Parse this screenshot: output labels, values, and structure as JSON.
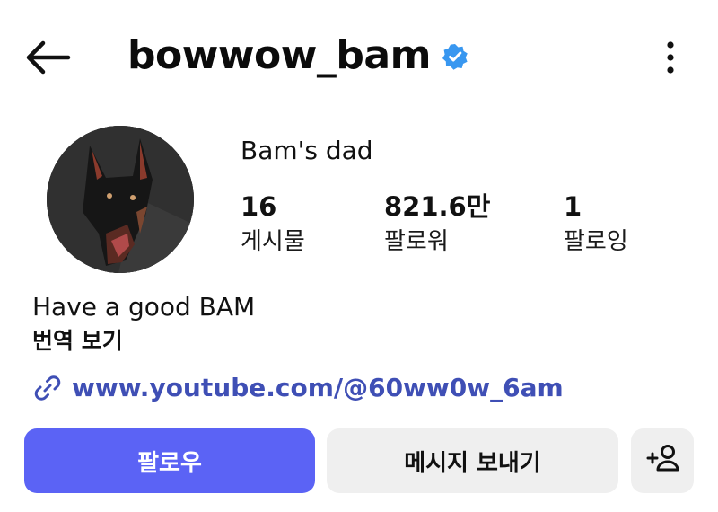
{
  "header": {
    "username": "bowwow_bam",
    "verified": true
  },
  "profile": {
    "display_name": "Bam's dad",
    "stats": [
      {
        "value": "16",
        "label": "게시물"
      },
      {
        "value": "821.6만",
        "label": "팔로워"
      },
      {
        "value": "1",
        "label": "팔로잉"
      }
    ],
    "bio": "Have a good BAM",
    "translate_label": "번역 보기",
    "link_text": "www.youtube.com/@60ww0w_6am"
  },
  "actions": {
    "follow_label": "팔로우",
    "message_label": "메시지 보내기"
  },
  "colors": {
    "accent": "#5b63f5",
    "link": "#3f4fb5",
    "verified": "#3897f0",
    "secondary_button": "#efefef"
  },
  "icons": {
    "back": "back-arrow-icon",
    "verified": "verified-badge-icon",
    "more": "more-vertical-icon",
    "link": "link-icon",
    "add_user": "add-user-icon"
  }
}
